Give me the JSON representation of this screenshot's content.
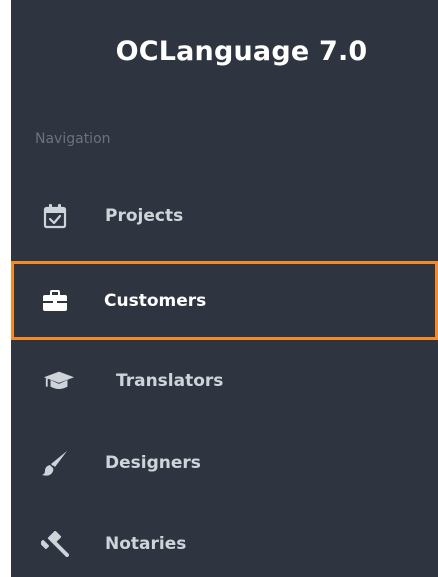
{
  "app": {
    "title": "OCLanguage 7.0"
  },
  "sidebar": {
    "heading": "Navigation",
    "items": [
      {
        "label": "Projects",
        "icon": "calendar-check-icon",
        "active": false
      },
      {
        "label": "Customers",
        "icon": "briefcase-icon",
        "active": true
      },
      {
        "label": "Translators",
        "icon": "graduation-cap-icon",
        "active": false
      },
      {
        "label": "Designers",
        "icon": "paint-brush-icon",
        "active": false
      },
      {
        "label": "Notaries",
        "icon": "gavel-icon",
        "active": false
      }
    ]
  },
  "colors": {
    "sidebar_bg": "#2e3540",
    "active_border": "#f58a2a",
    "text": "#cfd4da",
    "heading": "#6a7280"
  }
}
